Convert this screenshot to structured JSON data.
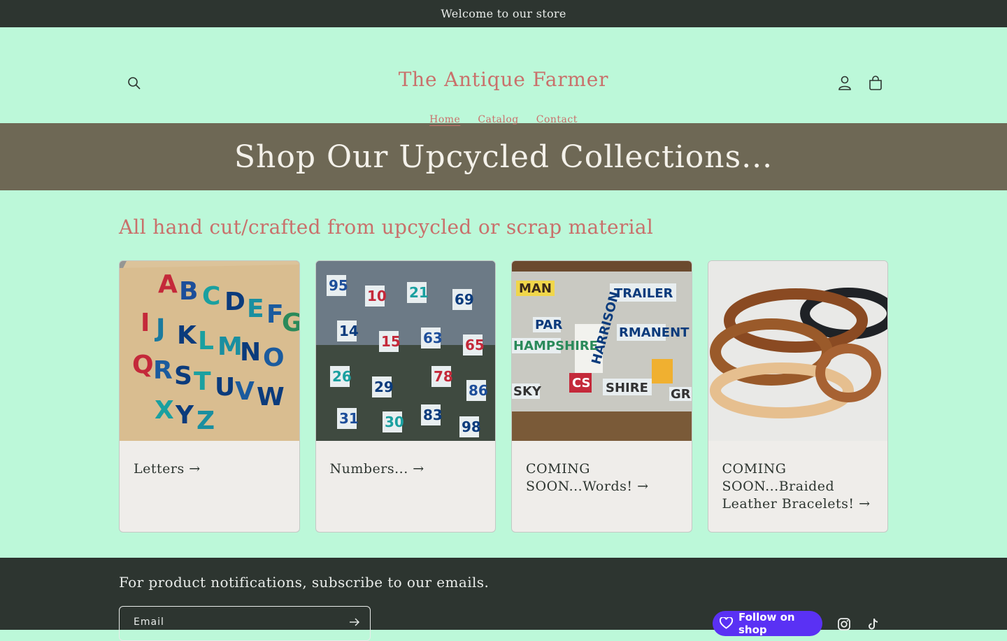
{
  "announcement": "Welcome to our store",
  "header": {
    "logo": "The Antique Farmer",
    "nav": [
      {
        "label": "Home"
      },
      {
        "label": "Catalog"
      },
      {
        "label": "Contact"
      }
    ],
    "icons": [
      "search-icon",
      "account-icon",
      "cart-icon"
    ]
  },
  "banner": {
    "title": "Shop Our Upcycled Collections..."
  },
  "collections": {
    "heading": "All hand cut/crafted from upcycled or scrap material",
    "cards": [
      {
        "title": "Letters",
        "image": "license-plate-letter-keychains"
      },
      {
        "title": "Numbers...",
        "image": "license-plate-number-keychains"
      },
      {
        "title": "COMING SOON...Words!",
        "image": "license-plate-word-scraps"
      },
      {
        "title": "COMING SOON...Braided Leather Bracelets!",
        "image": "braided-leather-bracelets"
      }
    ]
  },
  "footer": {
    "subscribe_title": "For product notifications, subscribe to our emails.",
    "email_label": "Email",
    "shop_button": "Follow on shop",
    "social": [
      "instagram-icon",
      "tiktok-icon"
    ]
  },
  "colors": {
    "background": "#bcf8d9",
    "accent": "#c9706b",
    "dark": "#2d3530",
    "banner": "#6e6855",
    "shop_purple": "#5a31f4"
  }
}
